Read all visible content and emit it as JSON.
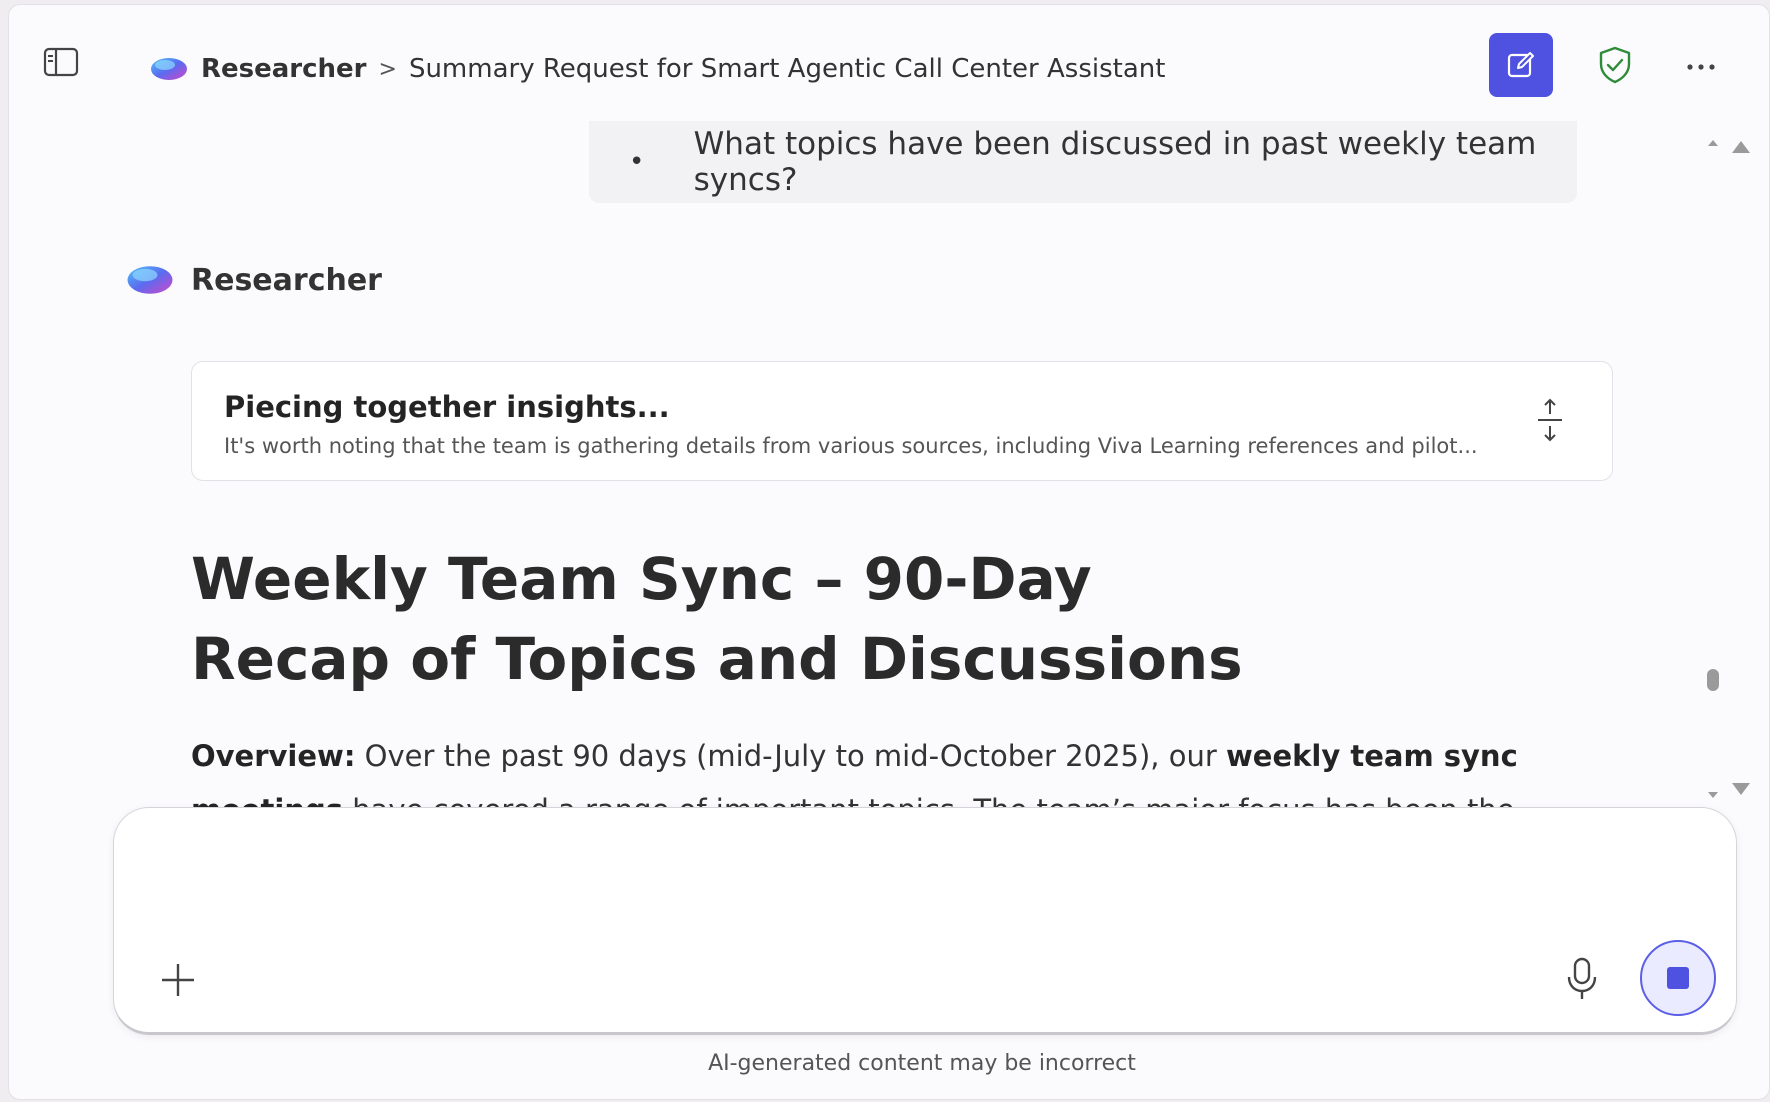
{
  "header": {
    "app_name": "Researcher",
    "separator": ">",
    "conversation_title": "Summary Request for Smart Agentic Call Center Assistant"
  },
  "user_message": {
    "bullet": "•",
    "text": "What topics have been discussed in past weekly team syncs?"
  },
  "assistant": {
    "name": "Researcher"
  },
  "progress": {
    "title": "Piecing together insights...",
    "subtitle": "It's worth noting that the team is gathering details from various sources, including Viva Learning references and pilot..."
  },
  "report": {
    "title": "Weekly Team Sync – 90-Day Recap of Topics and Discussions",
    "overview_label": "Overview:",
    "overview_text_1": " Over the past 90 days (mid-July to mid-October 2025), our ",
    "overview_bold": "weekly team sync meetings",
    "overview_text_2": " have covered a range of important topics. The team’s major focus has been the development and"
  },
  "composer": {
    "placeholder": ""
  },
  "footer": {
    "disclaimer": "AI-generated content may be incorrect"
  },
  "colors": {
    "accent": "#4f52e0",
    "shield": "#2e8b3a",
    "background": "#fbfafc"
  },
  "icons": {
    "sidebar": "sidebar-toggle-icon",
    "new_chat": "compose-icon",
    "shield": "shield-check-icon",
    "more": "more-horizontal-icon",
    "expand": "expand-vertical-icon",
    "add": "plus-icon",
    "mic": "microphone-icon",
    "stop": "stop-icon"
  }
}
